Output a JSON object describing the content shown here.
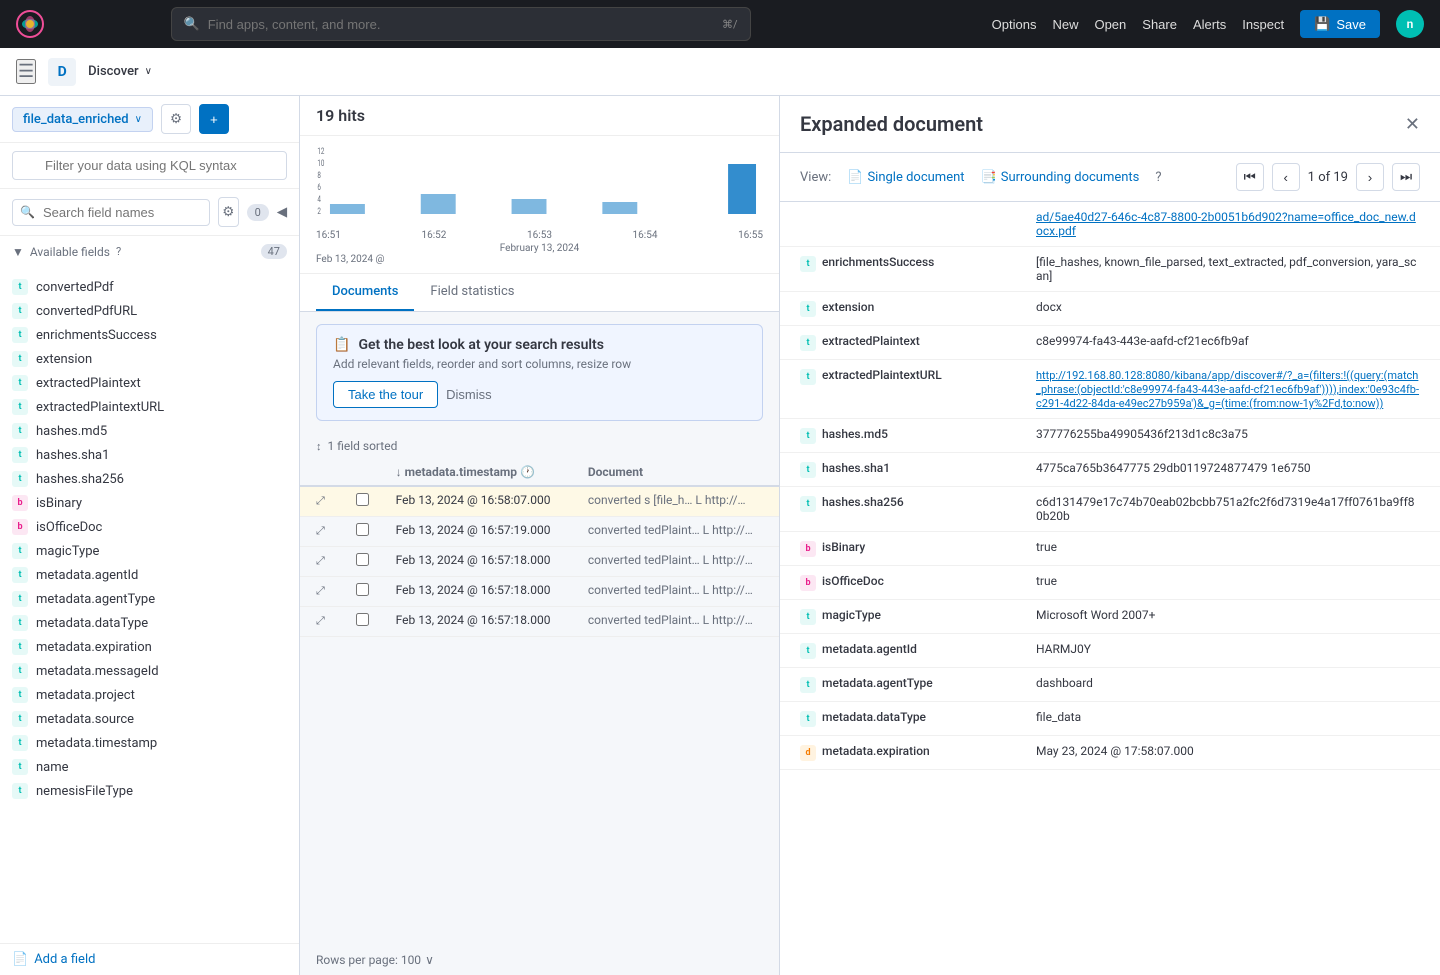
{
  "app": {
    "name": "Elastic"
  },
  "topNav": {
    "search_placeholder": "Find apps, content, and more.",
    "kbd_shortcut": "⌘/",
    "buttons": [
      "Options",
      "New",
      "Open",
      "Share",
      "Alerts",
      "Inspect"
    ],
    "save_label": "Save",
    "avatar_initial": "n"
  },
  "subNav": {
    "app_label": "D",
    "discover_label": "Discover",
    "chevron": "∨"
  },
  "sidebar": {
    "index_name": "file_data_enriched",
    "search_placeholder": "Search field names",
    "filter_count": "0",
    "available_fields_label": "Available fields",
    "available_fields_help": "?",
    "available_fields_count": "47",
    "fields": [
      {
        "name": "convertedPdf",
        "type": "t"
      },
      {
        "name": "convertedPdfURL",
        "type": "t"
      },
      {
        "name": "enrichmentsSuccess",
        "type": "t"
      },
      {
        "name": "extension",
        "type": "t"
      },
      {
        "name": "extractedPlaintext",
        "type": "t"
      },
      {
        "name": "extractedPlaintextURL",
        "type": "t"
      },
      {
        "name": "hashes.md5",
        "type": "t"
      },
      {
        "name": "hashes.sha1",
        "type": "t"
      },
      {
        "name": "hashes.sha256",
        "type": "t"
      },
      {
        "name": "isBinary",
        "type": "b"
      },
      {
        "name": "isOfficeDoc",
        "type": "b"
      },
      {
        "name": "magicType",
        "type": "t"
      },
      {
        "name": "metadata.agentId",
        "type": "t"
      },
      {
        "name": "metadata.agentType",
        "type": "t"
      },
      {
        "name": "metadata.dataType",
        "type": "t"
      },
      {
        "name": "metadata.expiration",
        "type": "t"
      },
      {
        "name": "metadata.messageId",
        "type": "t"
      },
      {
        "name": "metadata.project",
        "type": "t"
      },
      {
        "name": "metadata.source",
        "type": "t"
      },
      {
        "name": "metadata.timestamp",
        "type": "t"
      },
      {
        "name": "name",
        "type": "t"
      },
      {
        "name": "nemesisFileType",
        "type": "t"
      }
    ],
    "add_field_label": "Add a field"
  },
  "center": {
    "hits_count": "19 hits",
    "chart": {
      "time_labels": [
        "16:51",
        "16:52",
        "16:53",
        "16:54",
        "16:55"
      ],
      "date_label": "February 13, 2024",
      "bottom_label": "Feb 13, 2024 @"
    },
    "tabs": [
      "Documents",
      "Field statistics"
    ],
    "banner": {
      "title": "Get the best look at your search results",
      "description": "Add relevant fields, reorder and sort columns, resize row",
      "tour_label": "Take the tour",
      "dismiss_label": "Dismiss"
    },
    "sort_label": "1 field sorted",
    "sort_column": "metadata.timestamp",
    "column_headers": [
      "",
      "",
      "metadata.timestamp",
      "Document"
    ],
    "rows": [
      {
        "timestamp": "Feb 13, 2024 @ 16:58:07.000",
        "doc": "converted s [file_h… L http://…",
        "highlighted": true
      },
      {
        "timestamp": "Feb 13, 2024 @ 16:57:19.000",
        "doc": "converted tedPlaint… L http://…",
        "highlighted": false
      },
      {
        "timestamp": "Feb 13, 2024 @ 16:57:18.000",
        "doc": "converted tedPlaint… L http://…",
        "highlighted": false
      },
      {
        "timestamp": "Feb 13, 2024 @ 16:57:18.000",
        "doc": "converted tedPlaint… L http://…",
        "highlighted": false
      },
      {
        "timestamp": "Feb 13, 2024 @ 16:57:18.000",
        "doc": "converted tedPlaint… L http://…",
        "highlighted": false
      }
    ],
    "rows_per_page": "Rows per page: 100"
  },
  "expandedDoc": {
    "title": "Expanded document",
    "view_label": "View:",
    "single_doc_label": "Single document",
    "surrounding_docs_label": "Surrounding documents",
    "help_icon": "?",
    "current_page": "1",
    "total_pages": "19",
    "fields": [
      {
        "type": "link",
        "value": "ad/5ae40d27-646c-4c87-8800-2b0051b6d902?name=office_doc_new.docx.pdf"
      },
      {
        "name": "enrichmentsSuccess",
        "type": "t",
        "value": "[file_hashes, known_file_parsed, text_extracted, pdf_conversion, yara_scan]"
      },
      {
        "name": "extension",
        "type": "t",
        "value": "docx"
      },
      {
        "name": "extractedPlaintext",
        "type": "t",
        "value": "c8e99974-fa43-443e-aafd-cf21ec6fb9af"
      },
      {
        "name": "extractedPlaintextURL",
        "type": "t",
        "value": "http://192.168.80.128:8080/kibana/app/discover#/?_a=(filters:!((query:(match_phrase:(objectId:&#39;c8e99974-fa43-443e-aafd-cf21ec6fb9af&#39;)))),index:&#39;0e93c4fb-c291-4d22-84da-e49ec27b959a&#39;)&_g=(time:(from:now-1y%2Fd,to:now))"
      },
      {
        "name": "hashes.md5",
        "type": "t",
        "value": "377776255ba49905436f213d1c8c3a75"
      },
      {
        "name": "hashes.sha1",
        "type": "t",
        "value": "4775ca765b3647775 29db0119724877479 1e6750"
      },
      {
        "name": "hashes.sha256",
        "type": "t",
        "value": "c6d131479e17c74b70eab02bcbb751a2fc2f6d7319e4a17ff0761ba9ff80b20b"
      },
      {
        "name": "isBinary",
        "type": "b",
        "value": "true"
      },
      {
        "name": "isOfficeDoc",
        "type": "b",
        "value": "true"
      },
      {
        "name": "magicType",
        "type": "t",
        "value": "Microsoft Word 2007+"
      },
      {
        "name": "metadata.agentId",
        "type": "t",
        "value": "HARMJ0Y"
      },
      {
        "name": "metadata.agentType",
        "type": "t",
        "value": "dashboard"
      },
      {
        "name": "metadata.dataType",
        "type": "t",
        "value": "file_data"
      },
      {
        "name": "metadata.expiration",
        "type": "d",
        "value": "May 23, 2024 @ 17:58:07.000"
      }
    ]
  }
}
